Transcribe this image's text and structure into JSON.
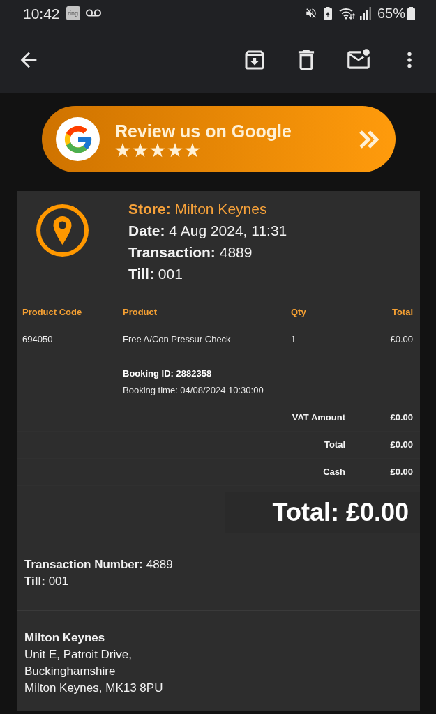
{
  "status_bar": {
    "time": "10:42",
    "app_badge": "ring",
    "battery": "65%"
  },
  "review_banner": {
    "title": "Review us on Google",
    "stars": 5
  },
  "receipt": {
    "store": "**Store:** Milton Keynes",
    "details": [
      "**Date:** 4 Aug 2024, 11:31",
      "**Transaction:** 4889",
      "**Till:** 001"
    ],
    "table": {
      "columns": [
        "Product Code",
        "Product",
        "Qty",
        "Total"
      ],
      "rows": [
        {
          "cells": [
            "694050",
            "Free A/Con Pressur Check",
            "1",
            "£0.00"
          ]
        }
      ]
    },
    "booking": [
      {
        "kind": "id",
        "text": "Booking ID: 2882358"
      },
      {
        "kind": "time",
        "text": "Booking time: 04/08/2024 10:30:00"
      }
    ],
    "totals": [
      {
        "label": "VAT Amount",
        "value": "£0.00"
      },
      {
        "label": "Total",
        "value": "£0.00"
      },
      {
        "label": "Cash",
        "value": "£0.00"
      }
    ],
    "grand_total": "Total: £0.00",
    "transaction_info": [
      "**Transaction Number:** 4889",
      "**Till:** 001"
    ],
    "address": {
      "name": "Milton Keynes",
      "lines": [
        "Unit E, Patroit Drive,",
        "Buckinghamshire",
        "Milton Keynes, MK13 8PU"
      ]
    }
  }
}
